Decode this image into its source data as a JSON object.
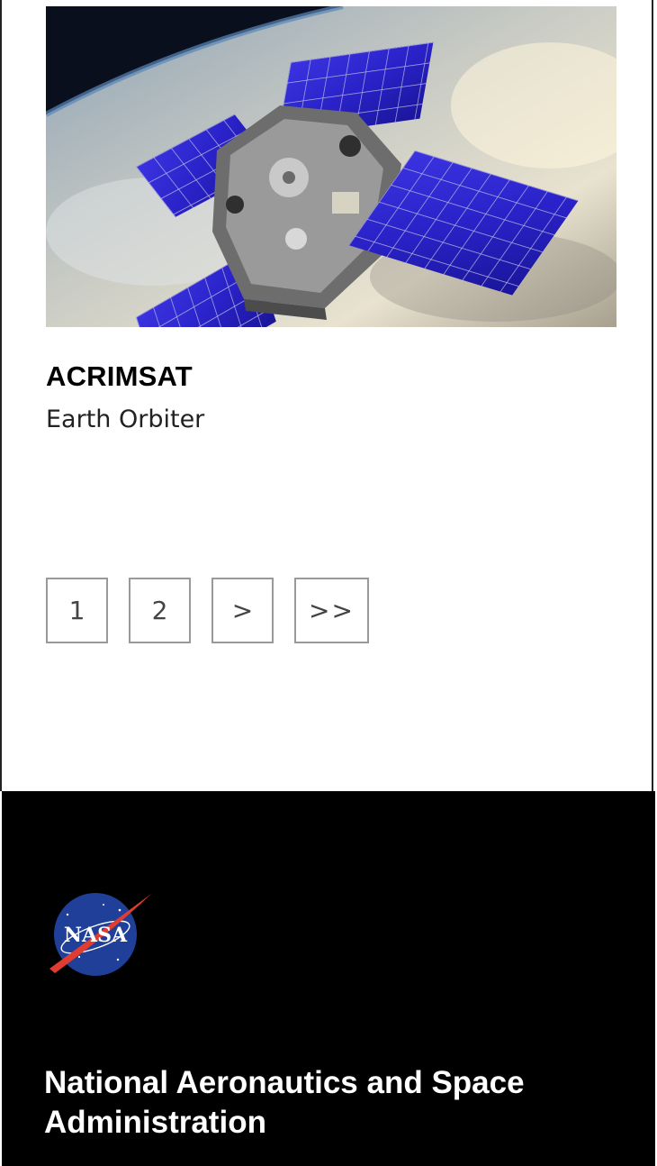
{
  "card": {
    "image_alt": "ACRIMSAT spacecraft with solar panels above Earth",
    "title": "ACRIMSAT",
    "subtitle": "Earth Orbiter"
  },
  "pagination": {
    "pages": [
      "1",
      "2"
    ],
    "next_label": ">",
    "last_label": ">>"
  },
  "footer": {
    "logo_text": "NASA",
    "org_name": "National Aeronautics and Space Administration"
  },
  "colors": {
    "footer_bg": "#000000",
    "panel_blue": "#2a22c8",
    "nasa_blue": "#1f3f99",
    "nasa_red": "#e03c31"
  }
}
